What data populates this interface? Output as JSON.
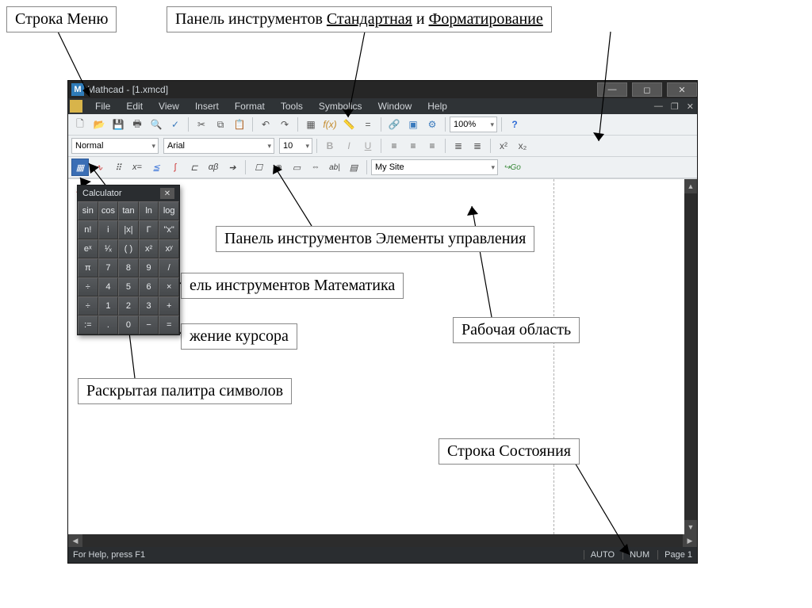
{
  "callouts": {
    "menu_row": "Строка  Меню",
    "toolbars_prefix": "Панель инструментов ",
    "toolbars_std": "Стандартная",
    "toolbars_and": " и ",
    "toolbars_fmt": "Форматирование",
    "controls": "Панель инструментов Элементы управления",
    "math": "ель инструментов Математика",
    "cursor": "жение курсора",
    "palette": "Раскрытая палитра символов",
    "workarea": "Рабочая область",
    "status": "Строка  Состояния"
  },
  "title": "Mathcad - [1.xmcd]",
  "menu": [
    "File",
    "Edit",
    "View",
    "Insert",
    "Format",
    "Tools",
    "Symbolics",
    "Window",
    "Help"
  ],
  "format_toolbar": {
    "style": "Normal",
    "font": "Arial",
    "size": "10"
  },
  "zoom": "100%",
  "resources_combo": "My Site",
  "go_btn": "Go",
  "status_left": "For Help, press F1",
  "status_right": [
    "AUTO",
    "NUM",
    "Page 1"
  ],
  "calculator": {
    "title": "Calculator",
    "keys": [
      "sin",
      "cos",
      "tan",
      "ln",
      "log",
      "n!",
      "i",
      "|x|",
      "Γ",
      "\"x\"",
      "eˣ",
      "¹⁄ₓ",
      "( )",
      "x²",
      "xʸ",
      "π",
      "7",
      "8",
      "9",
      "/",
      "÷",
      "4",
      "5",
      "6",
      "×",
      "÷",
      "1",
      "2",
      "3",
      "+",
      ":=",
      ".",
      "0",
      "−",
      "="
    ]
  }
}
